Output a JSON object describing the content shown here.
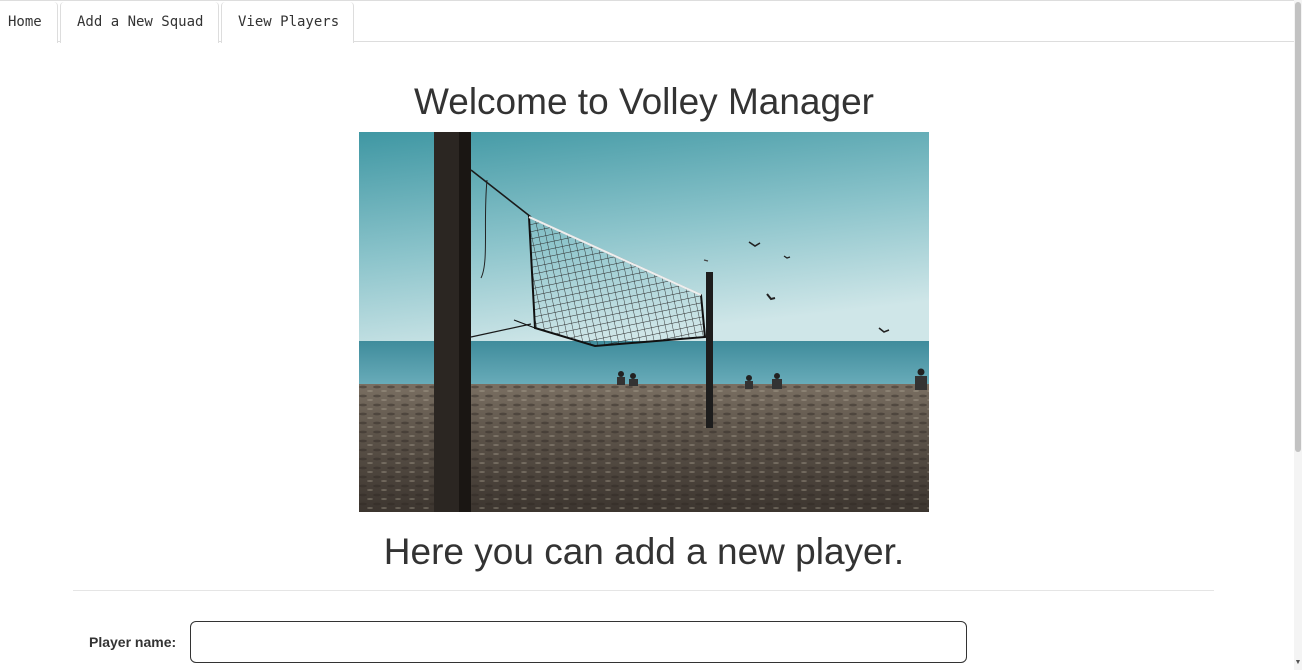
{
  "tabs": [
    {
      "label": "Home"
    },
    {
      "label": "Add a New Squad"
    },
    {
      "label": "View Players"
    }
  ],
  "main": {
    "heading": "Welcome to Volley Manager",
    "subheading": "Here you can add a new player."
  },
  "form": {
    "player_name_label": "Player name:",
    "player_name_value": ""
  }
}
